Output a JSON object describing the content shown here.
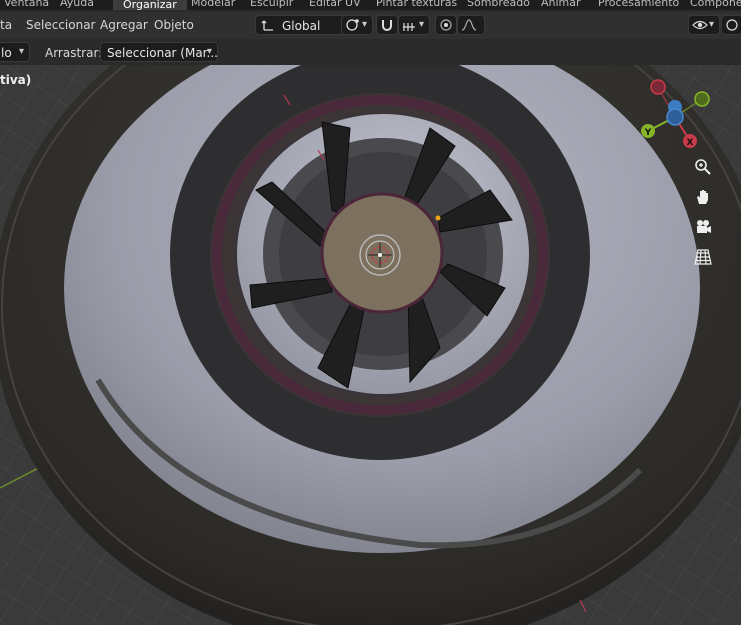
{
  "topbar": {
    "menus": [
      "Ventana",
      "Ayuda"
    ],
    "workspaces": [
      "Organizar",
      "Modelar",
      "Esculpir",
      "Editar UV",
      "Pintar texturas",
      "Sombreado",
      "Animar",
      "Procesamiento",
      "Componer"
    ],
    "active_workspace": "Organizar"
  },
  "header": {
    "menus": [
      "ta",
      "Seleccionar",
      "Agregar",
      "Objeto"
    ],
    "transform_orientation": "Global"
  },
  "tool_settings": {
    "mode_fragment": "lo",
    "drag_label": "Arrastrar:",
    "drag_value": "Seleccionar (Mar..."
  },
  "viewport": {
    "overlay_text": "tiva)",
    "gizmo": {
      "y_label": "Y",
      "x_label": "X",
      "z_label": ""
    },
    "nav_icons": [
      "zoom-icon",
      "hand-icon",
      "camera-icon",
      "grid-icon"
    ]
  },
  "colors": {
    "x_axis": "#c93a4a",
    "y_axis": "#86b52a",
    "z_axis": "#3a7dc4",
    "header_bg": "#303030"
  }
}
